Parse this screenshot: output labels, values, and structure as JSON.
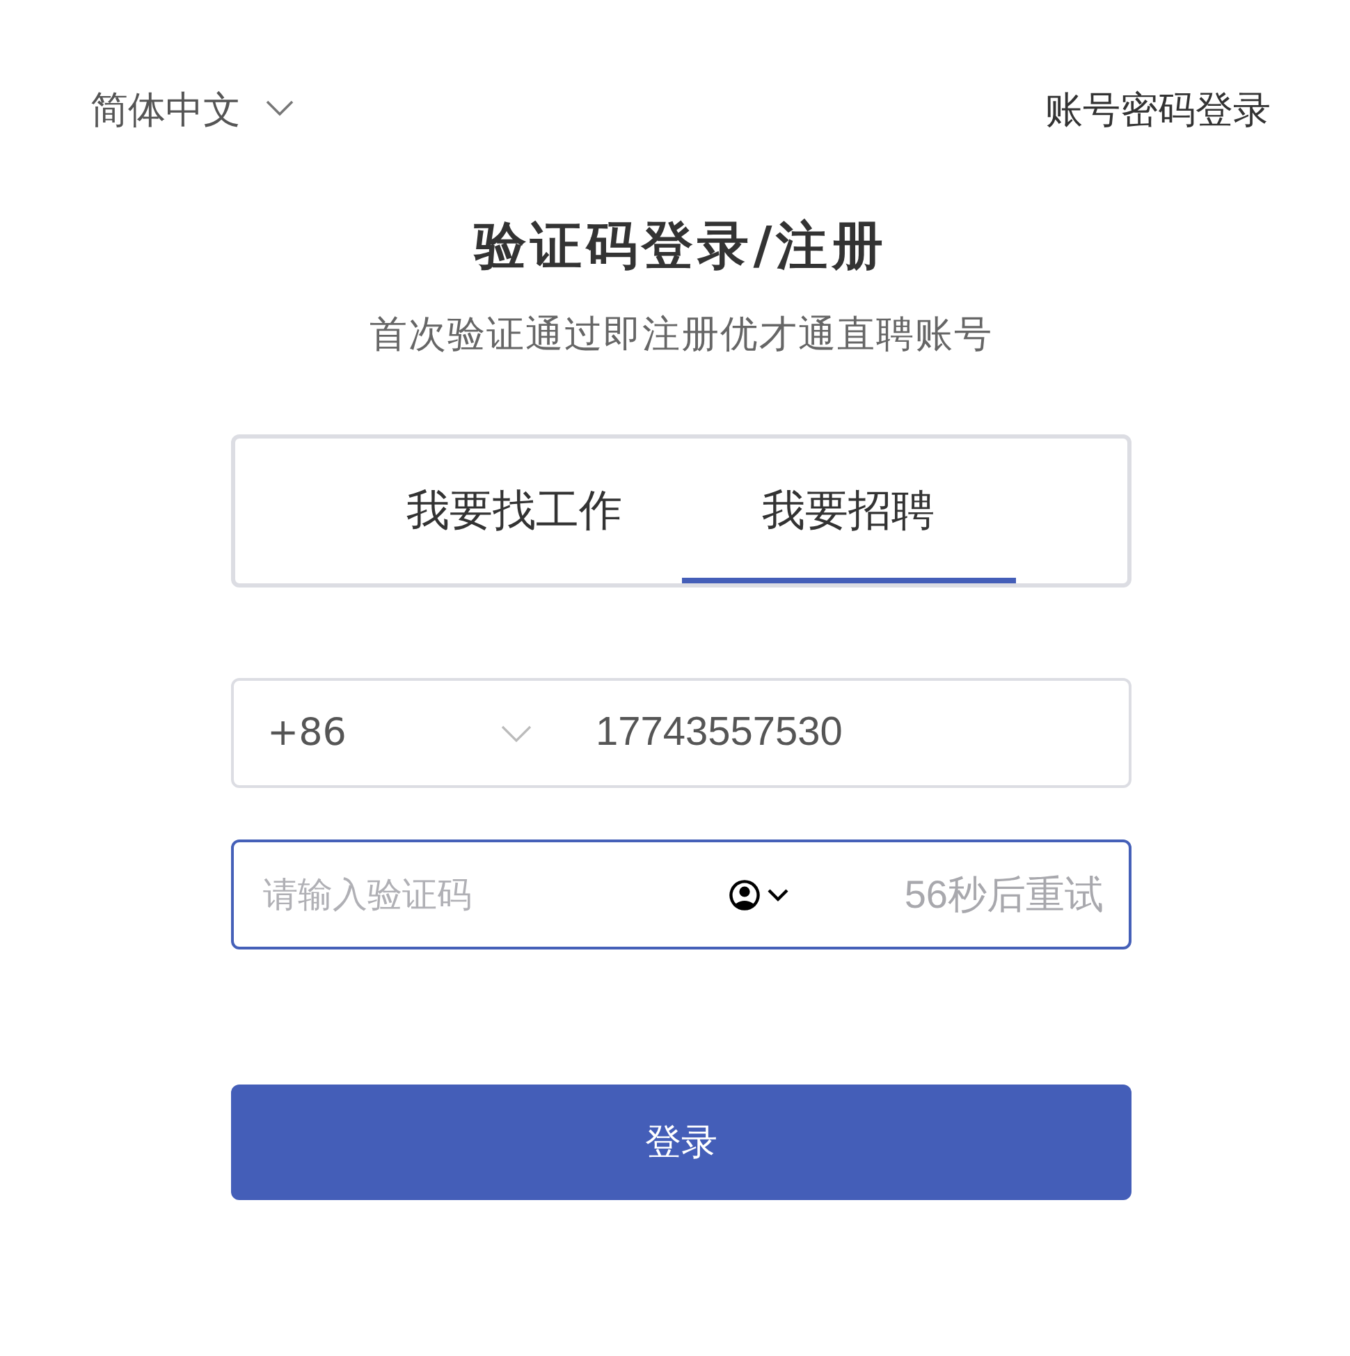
{
  "language_selector": {
    "label": "简体中文"
  },
  "password_login_link": {
    "label": "账号密码登录"
  },
  "title": "验证码登录/注册",
  "subtitle": "首次验证通过即注册优才通直聘账号",
  "tabs": [
    {
      "label": "我要找工作",
      "selected": false
    },
    {
      "label": "我要招聘",
      "selected": true
    }
  ],
  "phone_field": {
    "country_code": "+86",
    "value": "17743557530"
  },
  "code_field": {
    "placeholder": "请输入验证码",
    "focused": true,
    "resend_countdown": "56秒后重试"
  },
  "login_button": {
    "label": "登录"
  }
}
